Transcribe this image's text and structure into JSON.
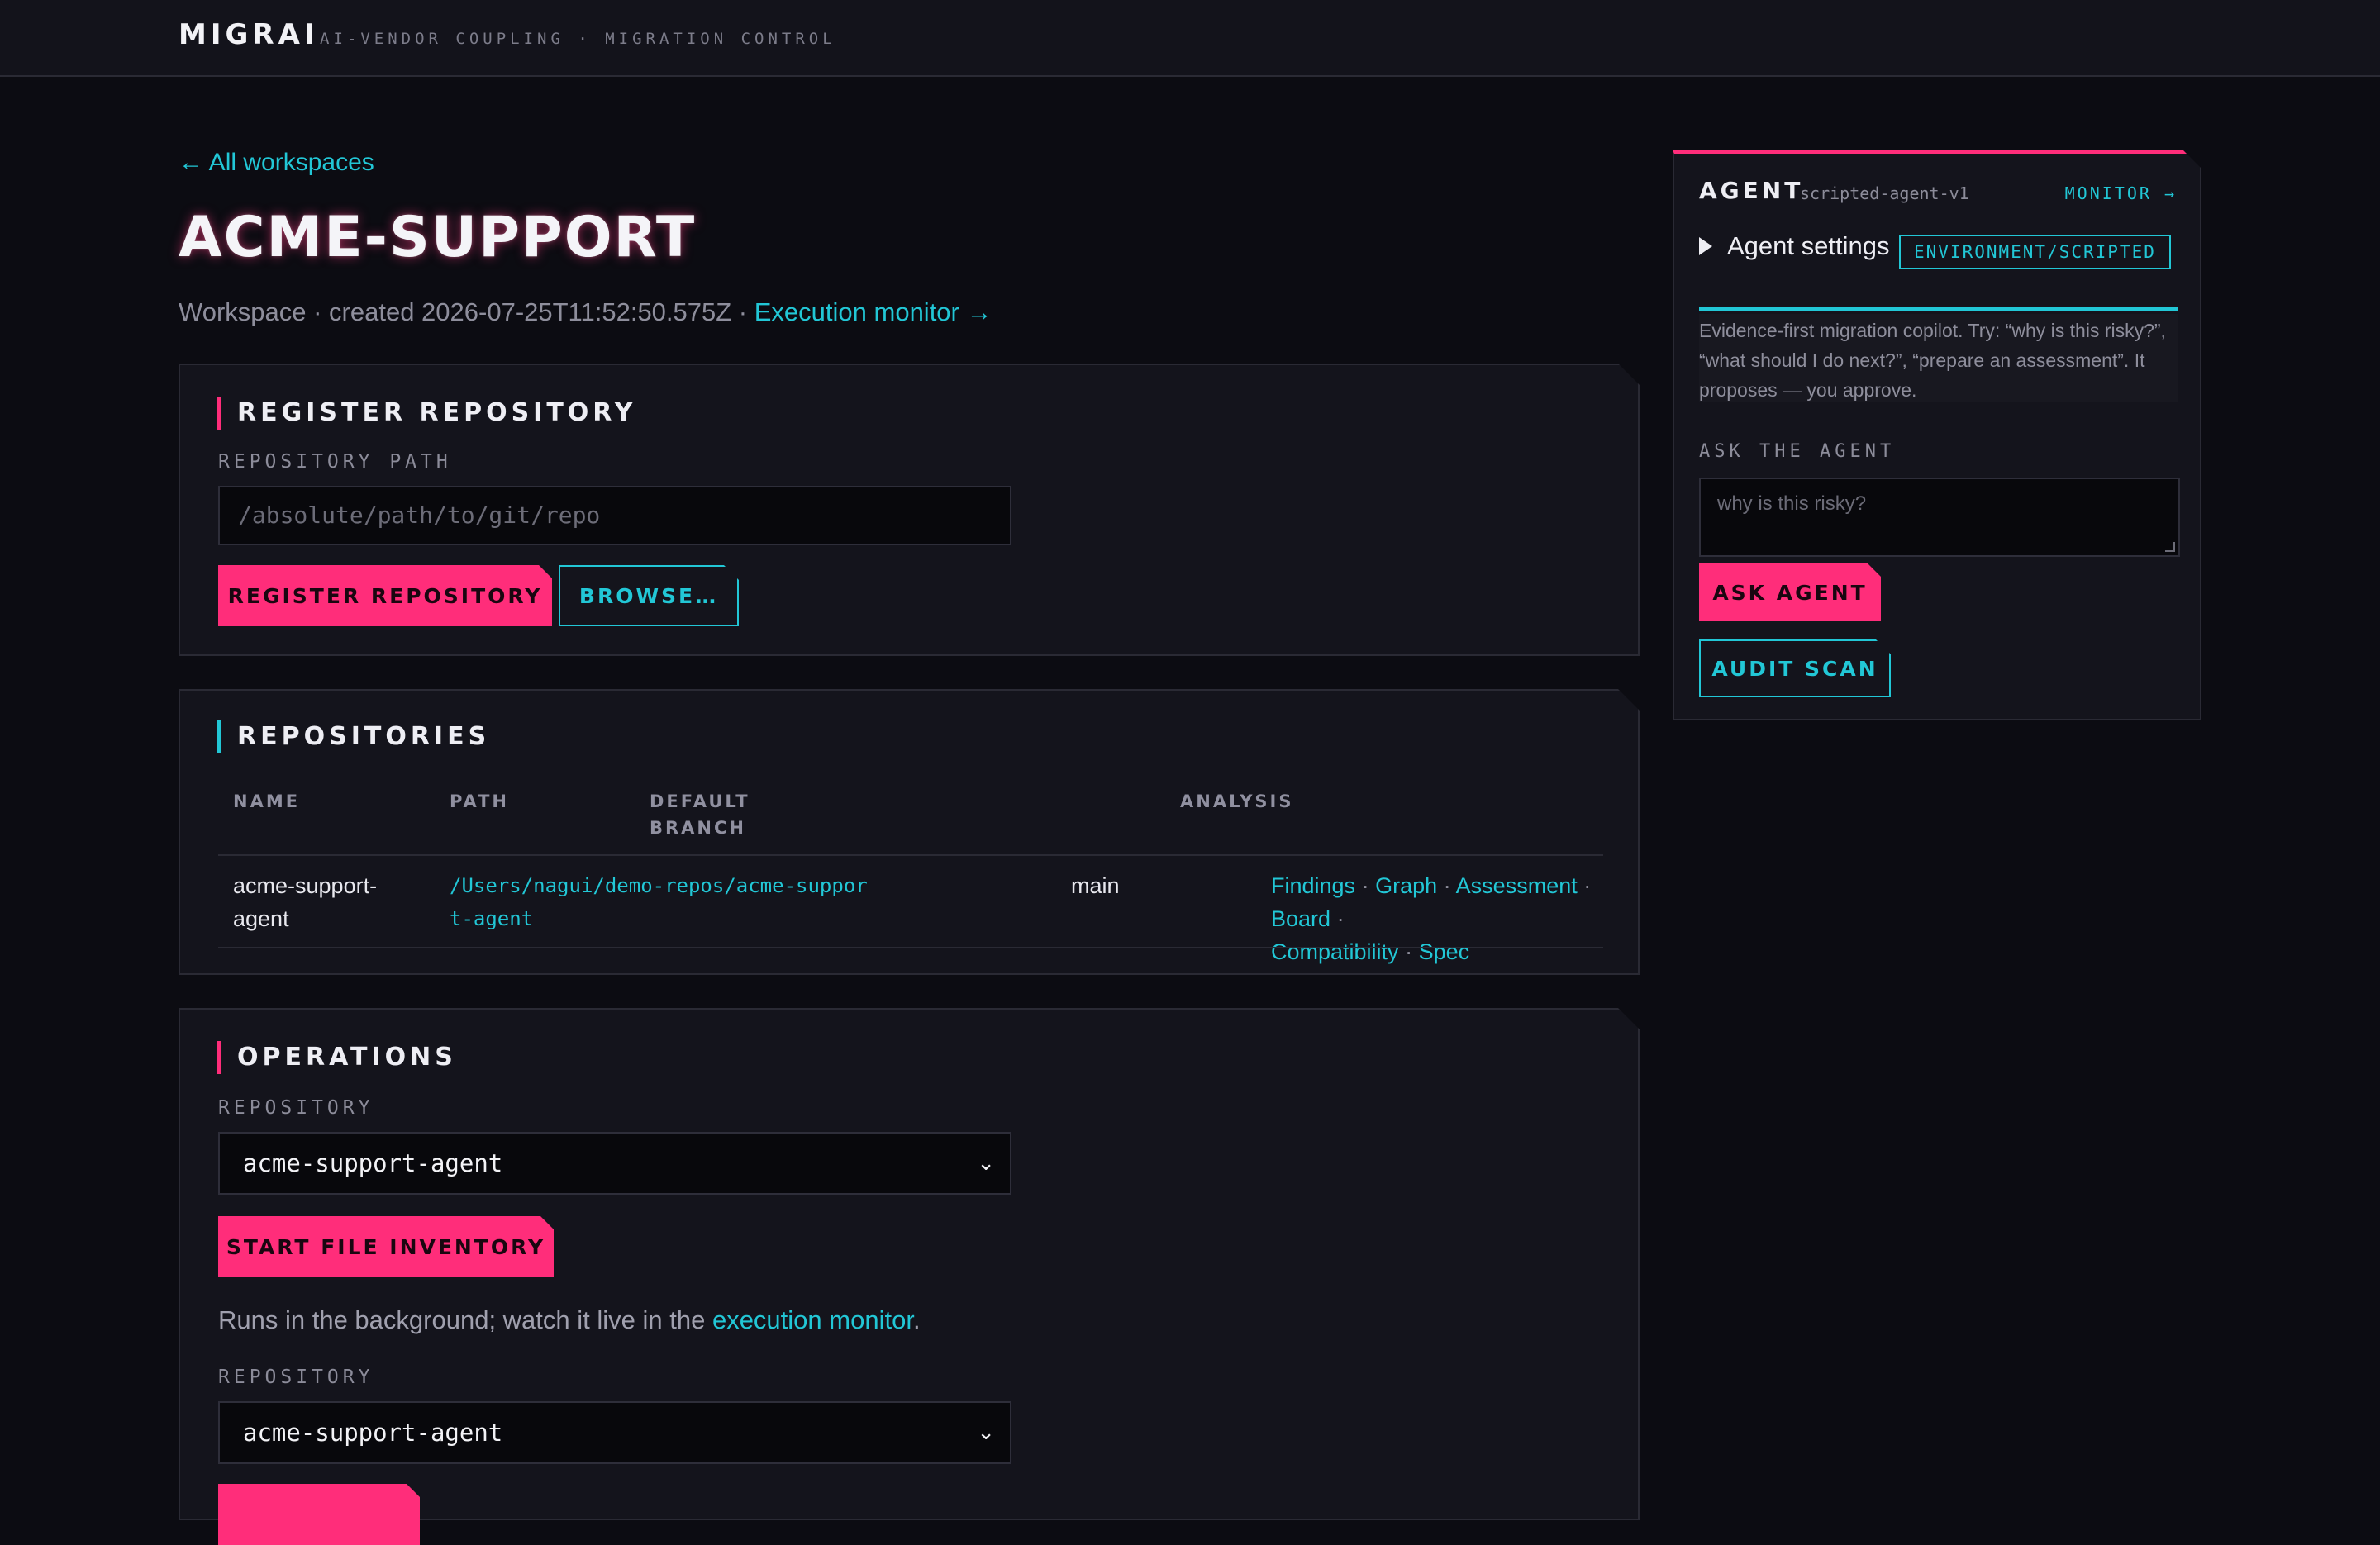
{
  "header": {
    "brand": "MIGRAI",
    "tagline": "AI-VENDOR COUPLING · MIGRATION CONTROL"
  },
  "workspace": {
    "back_link": "← All workspaces",
    "title": "ACME-SUPPORT",
    "meta_prefix": "Workspace · created 2026-07-25T11:52:50.575Z · ",
    "monitor_link": "Execution monitor →"
  },
  "register": {
    "title": "REGISTER REPOSITORY",
    "path_label": "REPOSITORY PATH",
    "path_placeholder": "/absolute/path/to/git/repo",
    "register_button": "REGISTER REPOSITORY",
    "browse_button": "BROWSE…"
  },
  "repositories": {
    "title": "REPOSITORIES",
    "columns": {
      "name": "NAME",
      "path": "PATH",
      "branch_line1": "DEFAULT",
      "branch_line2": "BRANCH",
      "analysis": "ANALYSIS"
    },
    "rows": [
      {
        "name_line1": "acme-support-",
        "name_line2": "agent",
        "path_line1": "/Users/nagui/demo-repos/acme-suppor",
        "path_line2": "t-agent",
        "branch": "main",
        "links": [
          "Findings",
          "Graph",
          "Assessment",
          "Board",
          "Compatibility",
          "Spec"
        ],
        "separator": "·"
      }
    ]
  },
  "operations": {
    "title": "OPERATIONS",
    "repo_label_1": "REPOSITORY",
    "repo_value_1": "acme-support-agent",
    "start_button": "START FILE INVENTORY",
    "note_prefix": "Runs in the background; watch it live in the ",
    "note_link": "execution monitor",
    "note_suffix": ".",
    "repo_label_2": "REPOSITORY",
    "repo_value_2": "acme-support-agent",
    "chevron": "⌄"
  },
  "agent": {
    "title": "AGENT",
    "agent_id": "scripted-agent-v1",
    "monitor_link": "MONITOR →",
    "settings_label": "Agent settings",
    "environment_badge": "ENVIRONMENT/SCRIPTED",
    "description": "Evidence-first migration copilot. Try: “why is this risky?”, “what should I do next?”, “prepare an assessment”. It proposes — you approve.",
    "ask_label": "ASK THE AGENT",
    "ask_placeholder": "why is this risky?",
    "ask_button": "ASK AGENT",
    "audit_button": "AUDIT SCAN"
  },
  "colors": {
    "accent_pink": "#ff2d7a",
    "accent_cyan": "#22c7d6",
    "background": "#0c0c12",
    "panel": "#14141c"
  }
}
